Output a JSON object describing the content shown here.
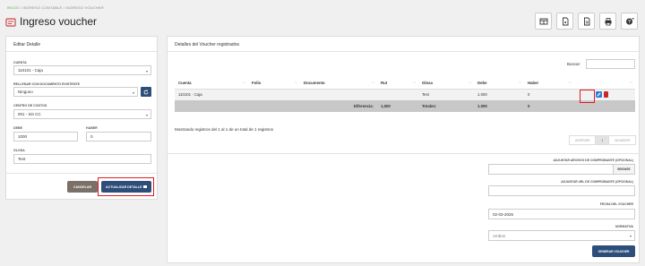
{
  "breadcrumb": {
    "home": "INICIO",
    "sep1": "/",
    "section": "INGRESO CONTABLE",
    "sep2": "/",
    "current": "INGRESO VOUCHER"
  },
  "page_title": "Ingreso voucher",
  "toolbar_icons": [
    "table-icon",
    "pdf-icon",
    "pdf-icon",
    "print-icon",
    "help-icon"
  ],
  "left_panel": {
    "title": "Editar Detalle",
    "cuenta": {
      "label": "CUENTA",
      "value": "110101 - Caja"
    },
    "rellenar": {
      "label": "RELLENAR CON DOCUMENTO EXISTENTE",
      "value": "Ninguno"
    },
    "centro": {
      "label": "CENTRO DE COSTOS",
      "value": "001 - Sin CC"
    },
    "debe": {
      "label": "DEBE",
      "value": "1000"
    },
    "haber": {
      "label": "HABER",
      "value": "0"
    },
    "glosa": {
      "label": "GLOSA",
      "value": "Test"
    },
    "cancel_label": "CANCELAR",
    "update_label": "ACTUALIZAR DETALLE"
  },
  "right_panel": {
    "title": "Detalles del Voucher registrados",
    "search_label": "Buscar:",
    "columns": [
      "Cuenta",
      "Folio",
      "Documento",
      "Rut",
      "Glosa",
      "Debe",
      "Haber",
      ""
    ],
    "row": {
      "cuenta": "110101 - Caja",
      "folio": "",
      "documento": "",
      "rut": "",
      "glosa": "Test",
      "debe": "1.000",
      "haber": "0"
    },
    "summary": {
      "diferencia_label": "Diferencia:",
      "diferencia_value": "1,000",
      "totales_label": "Totales:",
      "debe_total": "1.000",
      "haber_total": "0"
    },
    "showing": "Mostrando registros del 1 al 1 de un total de 1 registros",
    "pager": {
      "prev": "ANTERIOR",
      "page": "1",
      "next": "SIGUIENTE"
    },
    "adjuntar_archivo": {
      "label": "ADJUNTAR ARCHIVO DE COMPROBANTE (OPCIONAL)",
      "browse": "BROWSE"
    },
    "adjuntar_url": {
      "label": "ADJUNTAR URL DE COMPROBANTE (OPCIONAL)",
      "value": ""
    },
    "fecha": {
      "label": "FECHA DEL VOUCHER",
      "value": "02-03-2026"
    },
    "normativa": {
      "label": "NORMATIVA",
      "value": "Ambos"
    },
    "generate_label": "GENERAR VOUCHER"
  },
  "colors": {
    "primary": "#2c4e79",
    "accent_green": "#4caf50",
    "highlight": "#e01b24"
  }
}
